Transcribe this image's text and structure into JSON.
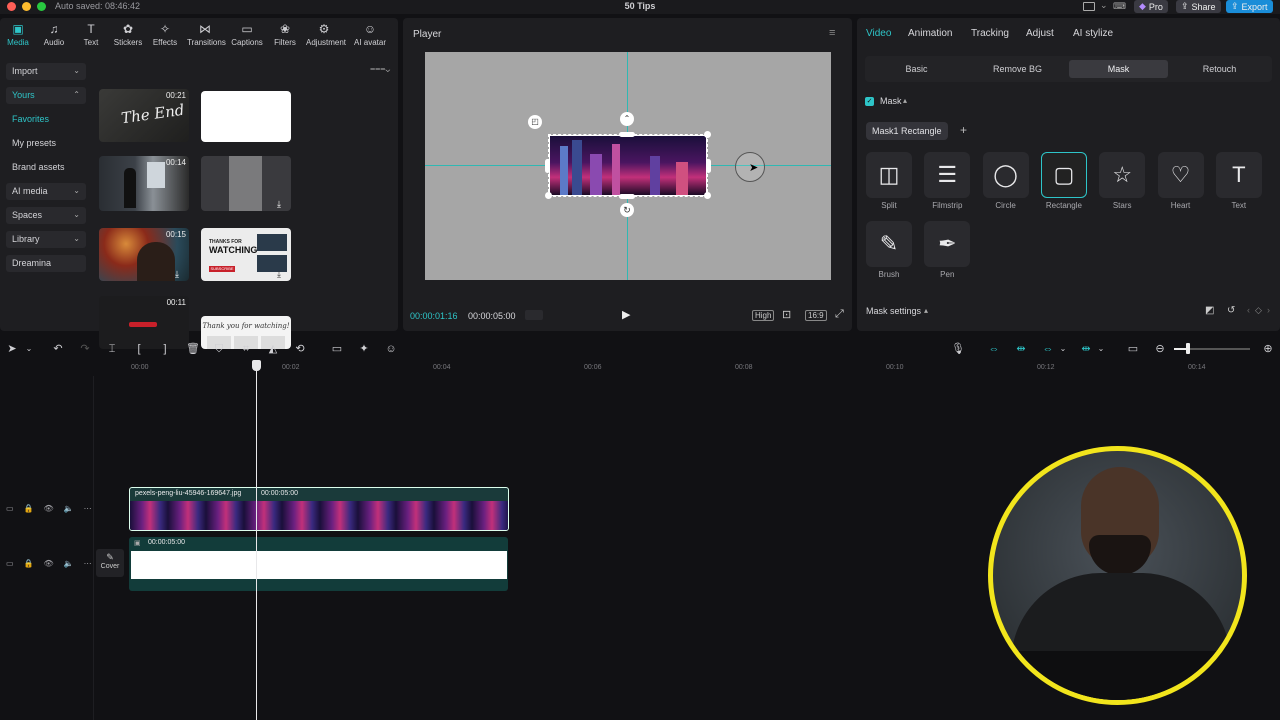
{
  "window": {
    "title": "50 Tips",
    "autosave": "Auto saved: 08:46:42",
    "pro_label": "Pro",
    "share_label": "Share",
    "export_label": "Export"
  },
  "tool_tabs": [
    {
      "label": "Media",
      "icon": "media-icon"
    },
    {
      "label": "Audio",
      "icon": "audio-icon"
    },
    {
      "label": "Text",
      "icon": "text-icon"
    },
    {
      "label": "Stickers",
      "icon": "stickers-icon"
    },
    {
      "label": "Effects",
      "icon": "effects-icon"
    },
    {
      "label": "Transitions",
      "icon": "transitions-icon"
    },
    {
      "label": "Captions",
      "icon": "captions-icon"
    },
    {
      "label": "Filters",
      "icon": "filters-icon"
    },
    {
      "label": "Adjustment",
      "icon": "adjustment-icon"
    },
    {
      "label": "AI avatar",
      "icon": "ai-avatar-icon"
    }
  ],
  "sidebar": {
    "items": [
      {
        "label": "Import",
        "chev": "⌄"
      },
      {
        "label": "Yours",
        "chev": "⌃"
      },
      {
        "label": "Favorites",
        "chev": ""
      },
      {
        "label": "My presets",
        "chev": ""
      },
      {
        "label": "Brand assets",
        "chev": ""
      },
      {
        "label": "AI media",
        "chev": "⌄"
      },
      {
        "label": "Spaces",
        "chev": "⌄"
      },
      {
        "label": "Library",
        "chev": "⌄"
      },
      {
        "label": "Dreamina",
        "chev": ""
      }
    ]
  },
  "media": {
    "durations": [
      "00:21",
      "00:14",
      "00:15",
      "00:11"
    ],
    "the_end_text": "The End",
    "thanks_text": "THANKS FOR",
    "watching_text": "WATCHING",
    "subscribe_text": "SUBSCRIBE",
    "thankyou_text": "Thank you for watching!"
  },
  "player": {
    "title": "Player",
    "current_time": "00:00:01:16",
    "total_time": "00:00:05:00",
    "quality": "High",
    "ratio": "16:9"
  },
  "right_panel": {
    "tabs": [
      "Video",
      "Animation",
      "Tracking",
      "Adjust",
      "AI stylize"
    ],
    "subtabs": [
      "Basic",
      "Remove BG",
      "Mask",
      "Retouch"
    ],
    "mask_label": "Mask",
    "mask_chip": "Mask1 Rectangle",
    "mask_types": [
      "Split",
      "Filmstrip",
      "Circle",
      "Rectangle",
      "Stars",
      "Heart",
      "Text",
      "Brush",
      "Pen"
    ],
    "mask_settings": "Mask settings"
  },
  "ruler": [
    "00:00",
    "00:02",
    "00:04",
    "00:06",
    "00:08",
    "00:10",
    "00:12",
    "00:14"
  ],
  "tracks": {
    "video_clip_name": "pexels-peng-liu-45946-169647.jpg",
    "video_clip_duration": "00:00:05:00",
    "white_clip_duration": "00:00:05:00",
    "cover_label": "Cover"
  },
  "colors": {
    "accent": "#2ec5c8",
    "export": "#1a8dd8",
    "webcam_ring": "#f2e51c"
  }
}
